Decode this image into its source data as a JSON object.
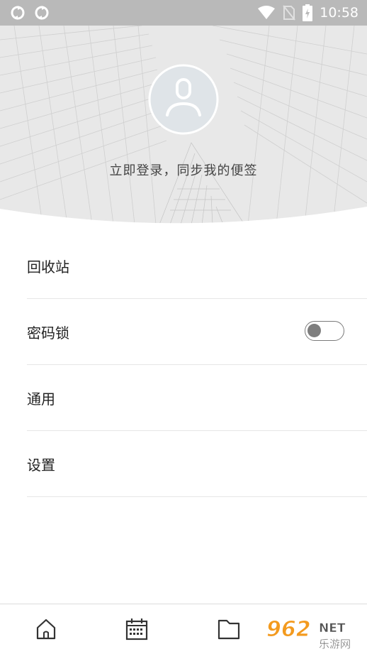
{
  "status_bar": {
    "time": "10:58",
    "icons": [
      "sync-icon",
      "sync-icon",
      "wifi-icon",
      "no-sim-icon",
      "battery-charging-icon"
    ]
  },
  "header": {
    "login_prompt": "立即登录，同步我的便签",
    "avatar_icon": "user-icon"
  },
  "menu": {
    "items": [
      {
        "label": "回收站"
      },
      {
        "label": "密码锁",
        "toggle_on": false
      },
      {
        "label": "通用"
      },
      {
        "label": "设置"
      }
    ]
  },
  "bottom_nav": {
    "items": [
      "home-icon",
      "calendar-icon",
      "folder-icon"
    ]
  },
  "watermark": {
    "brand": "962",
    "suffix": "NET",
    "subtitle": "乐游网"
  },
  "colors": {
    "status_bar_bg": "#b9b9b9",
    "header_bg": "#e8e8e8",
    "avatar_fill": "#dfe4e8",
    "watermark_orange": "#f39a1e"
  }
}
